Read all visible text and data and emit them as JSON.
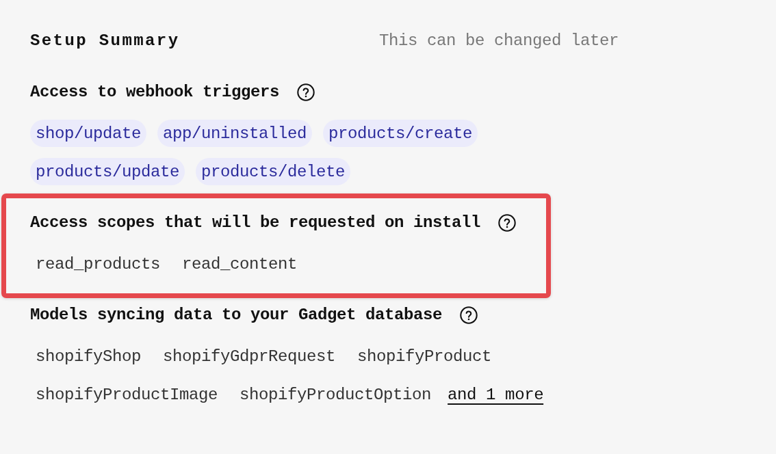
{
  "header": {
    "title": "Setup Summary",
    "note": "This can be changed later"
  },
  "sections": [
    {
      "heading": "Access to webhook triggers",
      "highlighted": false,
      "items": [
        {
          "kind": "tag",
          "label": "shop/update"
        },
        {
          "kind": "tag",
          "label": "app/uninstalled"
        },
        {
          "kind": "tag",
          "label": "products/create"
        },
        {
          "kind": "tag",
          "label": "products/update"
        },
        {
          "kind": "tag",
          "label": "products/delete"
        }
      ]
    },
    {
      "heading": "Access scopes that will be requested on install",
      "highlighted": true,
      "items": [
        {
          "kind": "name",
          "label": "read_products"
        },
        {
          "kind": "name",
          "label": "read_content"
        }
      ]
    },
    {
      "heading": "Models syncing data to your Gadget database",
      "highlighted": false,
      "items": [
        {
          "kind": "name",
          "label": "shopifyShop"
        },
        {
          "kind": "name",
          "label": "shopifyGdprRequest"
        },
        {
          "kind": "name",
          "label": "shopifyProduct"
        },
        {
          "kind": "name",
          "label": "shopifyProductImage"
        },
        {
          "kind": "name",
          "label": "shopifyProductOption"
        },
        {
          "kind": "link",
          "label": "and 1 more"
        }
      ]
    }
  ]
}
